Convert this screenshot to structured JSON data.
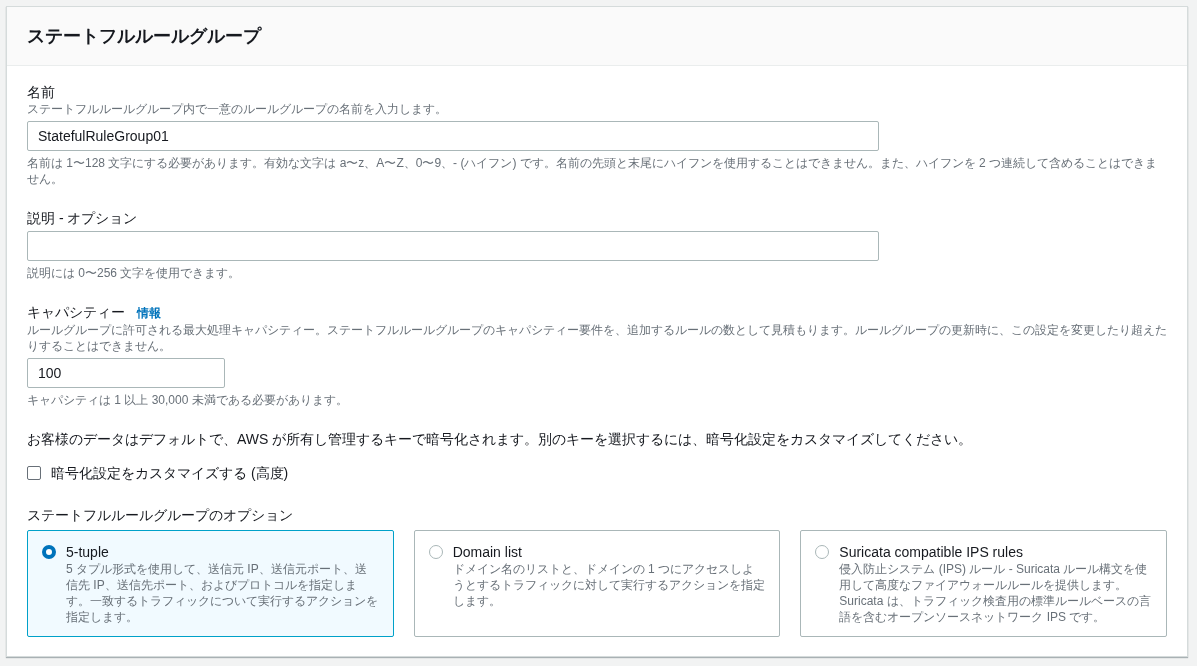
{
  "panel": {
    "title": "ステートフルルールグループ"
  },
  "name_field": {
    "label": "名前",
    "description": "ステートフルルールグループ内で一意のルールグループの名前を入力します。",
    "value": "StatefulRuleGroup01",
    "constraint": "名前は 1〜128 文字にする必要があります。有効な文字は a〜z、A〜Z、0〜9、- (ハイフン) です。名前の先頭と末尾にハイフンを使用することはできません。また、ハイフンを 2 つ連続して含めることはできません。"
  },
  "description_field": {
    "label": "説明 - オプション",
    "constraint": "説明には 0〜256 文字を使用できます。"
  },
  "capacity_field": {
    "label": "キャパシティー",
    "info_link": "情報",
    "description": "ルールグループに許可される最大処理キャパシティー。ステートフルルールグループのキャパシティー要件を、追加するルールの数として見積もります。ルールグループの更新時に、この設定を変更したり超えたりすることはできません。",
    "value": "100",
    "constraint": "キャパシティは 1 以上 30,000 未満である必要があります。"
  },
  "encryption_note": "お客様のデータはデフォルトで、AWS が所有し管理するキーで暗号化されます。別のキーを選択するには、暗号化設定をカスタマイズしてください。",
  "customize_encryption": {
    "label": "暗号化設定をカスタマイズする (高度)",
    "checked": false
  },
  "options": {
    "label": "ステートフルルールグループのオプション",
    "items": [
      {
        "title": "5-tuple",
        "description": "5 タプル形式を使用して、送信元 IP、送信元ポート、送信先 IP、送信先ポート、およびプロトコルを指定します。一致するトラフィックについて実行するアクションを指定します。",
        "selected": true
      },
      {
        "title": "Domain list",
        "description": "ドメイン名のリストと、ドメインの 1 つにアクセスしようとするトラフィックに対して実行するアクションを指定します。",
        "selected": false
      },
      {
        "title": "Suricata compatible IPS rules",
        "description": "侵入防止システム (IPS) ルール - Suricata ルール構文を使用して高度なファイアウォールルールを提供します。Suricata は、トラフィック検査用の標準ルールベースの言語を含むオープンソースネットワーク IPS です。",
        "selected": false
      }
    ]
  }
}
